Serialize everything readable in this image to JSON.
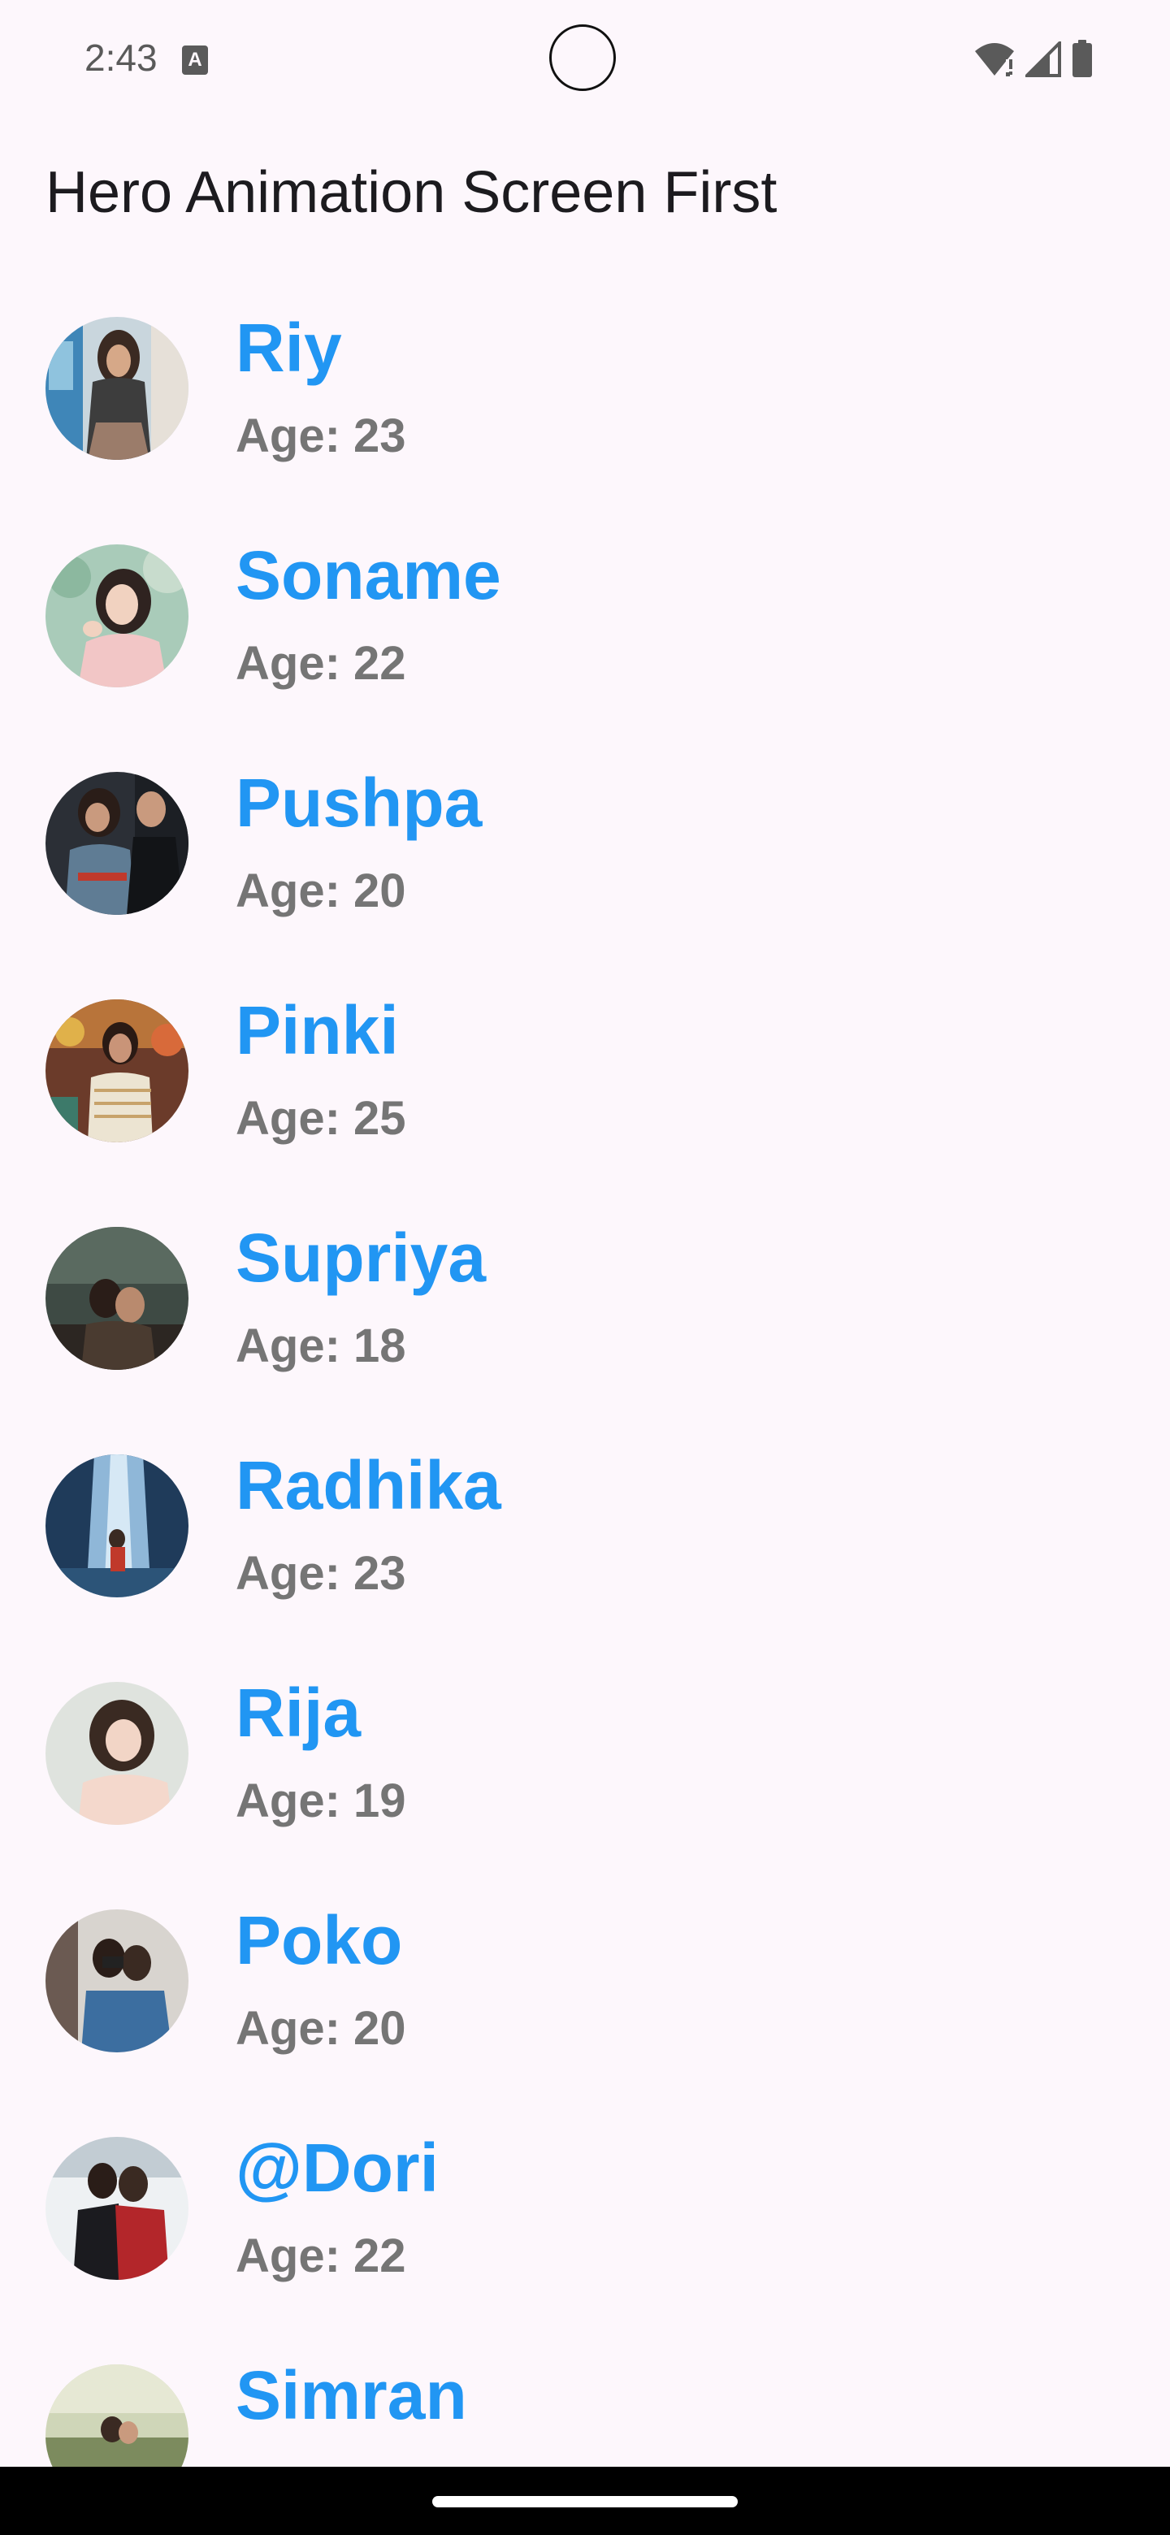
{
  "status_bar": {
    "time": "2:43",
    "notification_icon": "a-icon",
    "notification_glyph": "A",
    "icons": [
      "wifi-icon",
      "signal-icon",
      "battery-icon"
    ]
  },
  "app_bar": {
    "title": "Hero Animation Screen First"
  },
  "colors": {
    "background": "#fdf7fc",
    "name_color": "#2196f3",
    "age_color": "#757575",
    "title_color": "#1c1b1f"
  },
  "list": {
    "items": [
      {
        "name": "Riy",
        "age": "Age: 23"
      },
      {
        "name": "Soname",
        "age": "Age: 22"
      },
      {
        "name": "Pushpa",
        "age": "Age: 20"
      },
      {
        "name": "Pinki",
        "age": "Age: 25"
      },
      {
        "name": "Supriya",
        "age": "Age: 18"
      },
      {
        "name": "Radhika",
        "age": "Age: 23"
      },
      {
        "name": "Rija",
        "age": "Age: 19"
      },
      {
        "name": "Poko",
        "age": "Age: 20"
      },
      {
        "name": "@Dori",
        "age": "Age: 22"
      },
      {
        "name": "Simran",
        "age": ""
      }
    ]
  },
  "nav": {
    "handle": "gesture-handle"
  }
}
